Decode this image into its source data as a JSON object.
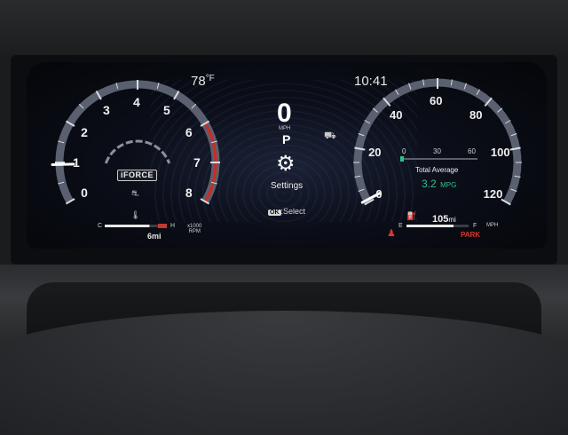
{
  "header": {
    "temperature": "78",
    "temperature_unit": "°F",
    "clock": "10:41"
  },
  "tachometer": {
    "rpm_labels": [
      "0",
      "1",
      "2",
      "3",
      "4",
      "5",
      "6",
      "7",
      "8"
    ],
    "unit_line1": "x1000",
    "unit_line2": "RPM",
    "brand_logo_text": "iFORCE",
    "temp_gauge": {
      "cold_label": "C",
      "hot_label": "H",
      "level": 0.72
    },
    "trip_readout": "6mi"
  },
  "center": {
    "speed": "0",
    "speed_unit": "MPH",
    "gear": "P",
    "menu_label": "Settings",
    "hint_button": "OK",
    "hint_text": ":Select"
  },
  "speedometer": {
    "speed_labels": [
      "0",
      "20",
      "40",
      "60",
      "80",
      "100",
      "120"
    ],
    "unit": "MPH",
    "economy_scale": [
      "0",
      "30",
      "60"
    ],
    "average_title": "Total Average",
    "average_value": "3.2",
    "average_unit": "MPG",
    "fuel_gauge": {
      "empty_label": "E",
      "full_label": "F",
      "level": 0.75
    },
    "range_value": "105",
    "range_unit": "mi",
    "park_status": "PARK"
  },
  "colors": {
    "needle": "#ffffff",
    "redline": "#d12a1e",
    "economy_green": "#27c48a",
    "park_red": "#e0342a"
  },
  "icons": {
    "temperature": "thermometer-icon",
    "trac": "traction-control-icon",
    "settings": "gear-icon",
    "fuel": "fuel-pump-icon",
    "seatbelt": "seatbelt-warning-icon"
  }
}
